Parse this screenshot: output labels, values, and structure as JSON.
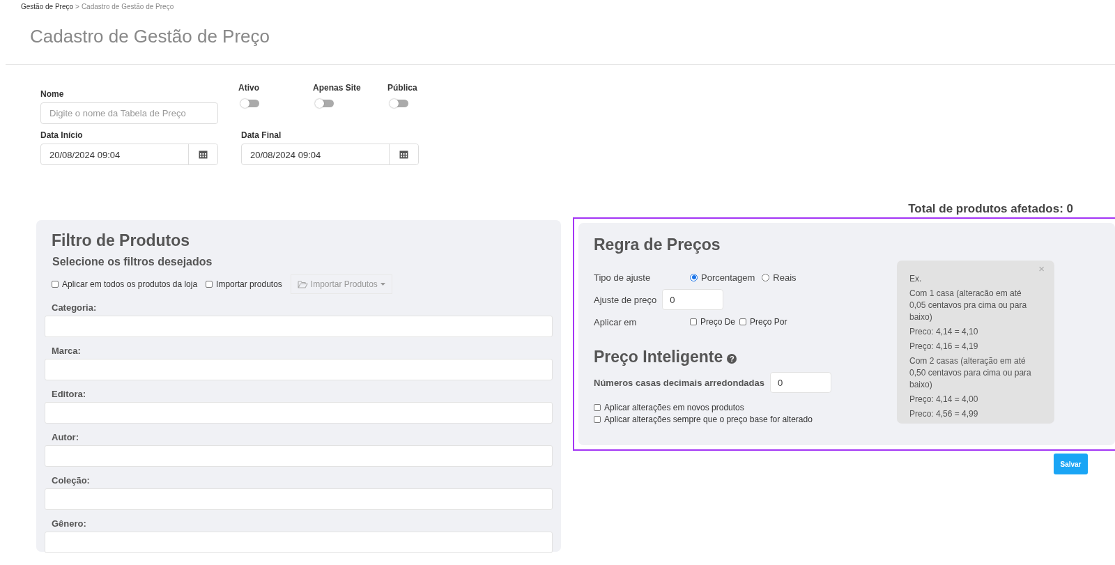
{
  "breadcrumb": {
    "items": [
      {
        "label": "Gestão de Preço"
      },
      {
        "label": "Cadastro de Gestão de Preço"
      }
    ],
    "separator": ">"
  },
  "page_title": "Cadastro de Gestão de Preço",
  "form": {
    "name": {
      "label": "Nome",
      "placeholder": "Digite o nome da Tabela de Preço"
    },
    "toggles": [
      {
        "label": "Ativo",
        "on": false
      },
      {
        "label": "Apenas Site",
        "on": false
      },
      {
        "label": "Pública",
        "on": false
      }
    ],
    "dates": [
      {
        "label": "Data Início",
        "value": "20/08/2024 09:04"
      },
      {
        "label": "Data Final",
        "value": "20/08/2024 09:04"
      }
    ]
  },
  "total_label": "Total de produtos afetados: 0",
  "product_filter": {
    "title": "Filtro de Produtos",
    "subtitle": "Selecione os filtros desejados",
    "options": [
      {
        "label": "Aplicar em todos os produtos da loja",
        "checked": false
      },
      {
        "label": "Importar produtos",
        "checked": false
      }
    ],
    "import_button": {
      "label": "Importar Produtos",
      "disabled": true
    },
    "fields": [
      {
        "label": "Categoria:"
      },
      {
        "label": "Marca:"
      },
      {
        "label": "Editora:"
      },
      {
        "label": "Autor:"
      },
      {
        "label": "Coleção:"
      },
      {
        "label": "Gênero:"
      }
    ]
  },
  "price_rule": {
    "title": "Regra de Preços",
    "adjust_type": {
      "label": "Tipo de ajuste",
      "options": [
        {
          "label": "Porcentagem",
          "selected": true
        },
        {
          "label": "Reais",
          "selected": false
        }
      ]
    },
    "adjust_value": {
      "label": "Ajuste de preço",
      "value": "0"
    },
    "apply_in": {
      "label": "Aplicar em",
      "options": [
        {
          "label": "Preço De",
          "checked": false
        },
        {
          "label": "Preço Por",
          "checked": false
        }
      ]
    }
  },
  "smart_price": {
    "title": "Preço Inteligente",
    "help": "?",
    "decimals": {
      "label": "Números casas decimais arredondadas",
      "value": "0"
    },
    "options": [
      {
        "label": "Aplicar alterações em novos produtos",
        "checked": false
      },
      {
        "label": "Aplicar alterações sempre que o preço base for alterado",
        "checked": false
      }
    ]
  },
  "example_box": {
    "close": "×",
    "lines": [
      "Ex.",
      "Com 1 casa (alteracão em até 0,05 centavos pra cima ou para baixo)",
      "Preco: 4,14 = 4,10",
      "Preço: 4,16 = 4,19",
      "Com 2 casas (alteração em até 0,50 centavos para cima ou para baixo)",
      "Preço: 4,14 = 4,00",
      "Preco: 4,56 = 4,99"
    ]
  },
  "save_button": "Salvar"
}
